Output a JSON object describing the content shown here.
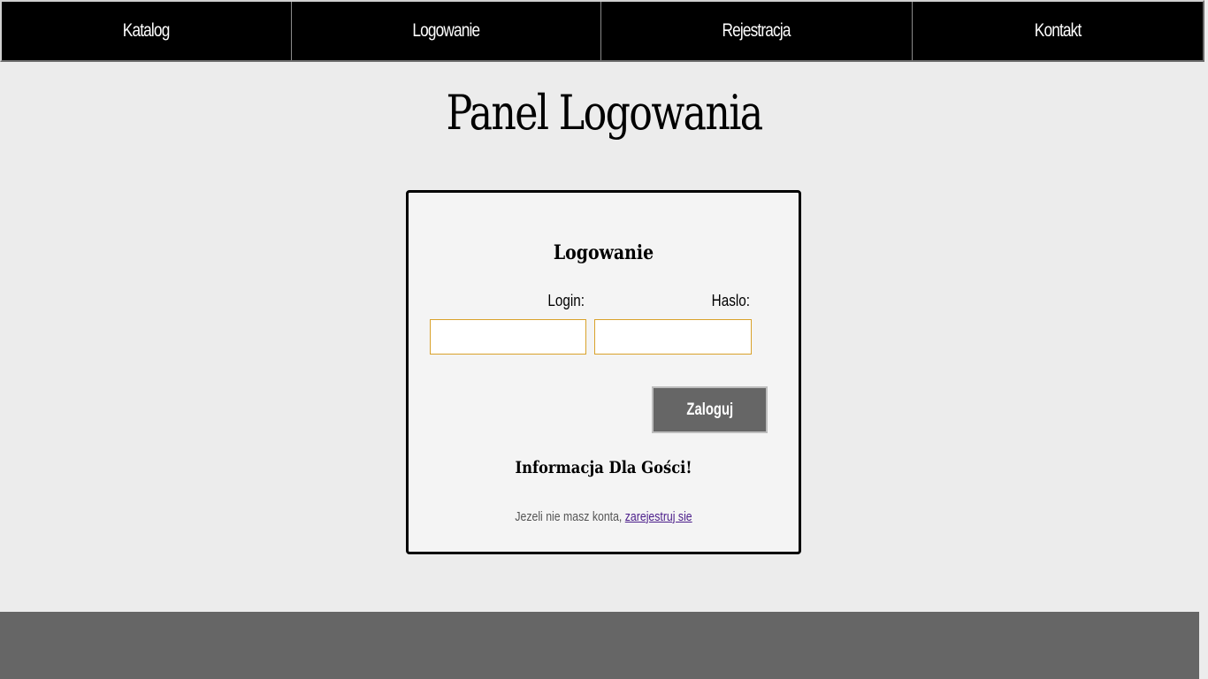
{
  "nav": {
    "items": [
      {
        "label": "Katalog"
      },
      {
        "label": "Logowanie"
      },
      {
        "label": "Rejestracja"
      },
      {
        "label": "Kontakt"
      }
    ]
  },
  "page_title": "Panel Logowania",
  "login_panel": {
    "heading": "Logowanie",
    "login_label": "Login:",
    "password_label": "Haslo:",
    "login_value": "",
    "password_value": "",
    "submit_label": "Zaloguj",
    "guest_heading": "Informacja Dla Gości!",
    "guest_text": "Jezeli nie masz konta, ",
    "register_link": "zarejestruj sie"
  },
  "colors": {
    "nav_background": "#000000",
    "page_background": "#ececec",
    "input_border": "#d9a22b",
    "button_background": "#666666",
    "link_color": "#4b1d8a",
    "footer_background": "#666666"
  }
}
